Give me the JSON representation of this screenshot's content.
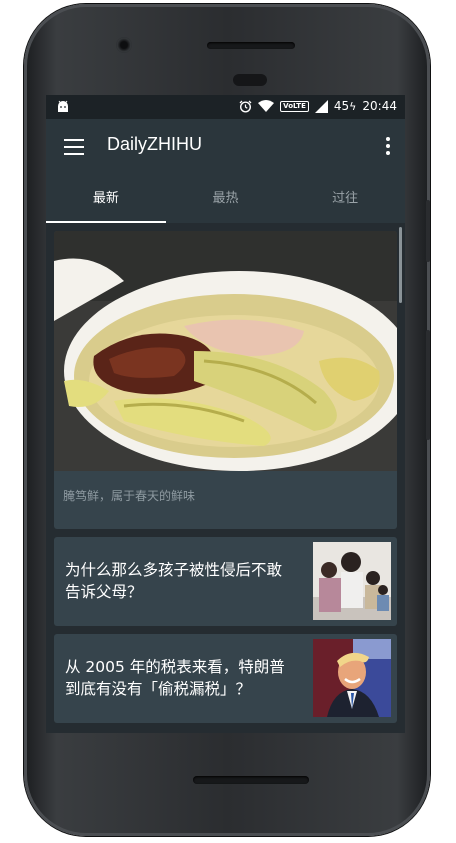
{
  "status": {
    "battery": "45",
    "time": "20:44",
    "volte": "VoLTE"
  },
  "appbar": {
    "title": "DailyZHIHU"
  },
  "tabs": [
    {
      "label": "最新"
    },
    {
      "label": "最热"
    },
    {
      "label": "过往"
    }
  ],
  "stories": {
    "hero": {
      "caption": "腌笃鲜，属于春天的鲜味"
    },
    "items": [
      {
        "title": "为什么那么多孩子被性侵后不敢告诉父母？"
      },
      {
        "title": "从 2005 年的税表来看，特朗普到底有没有「偷税漏税」？"
      }
    ]
  }
}
